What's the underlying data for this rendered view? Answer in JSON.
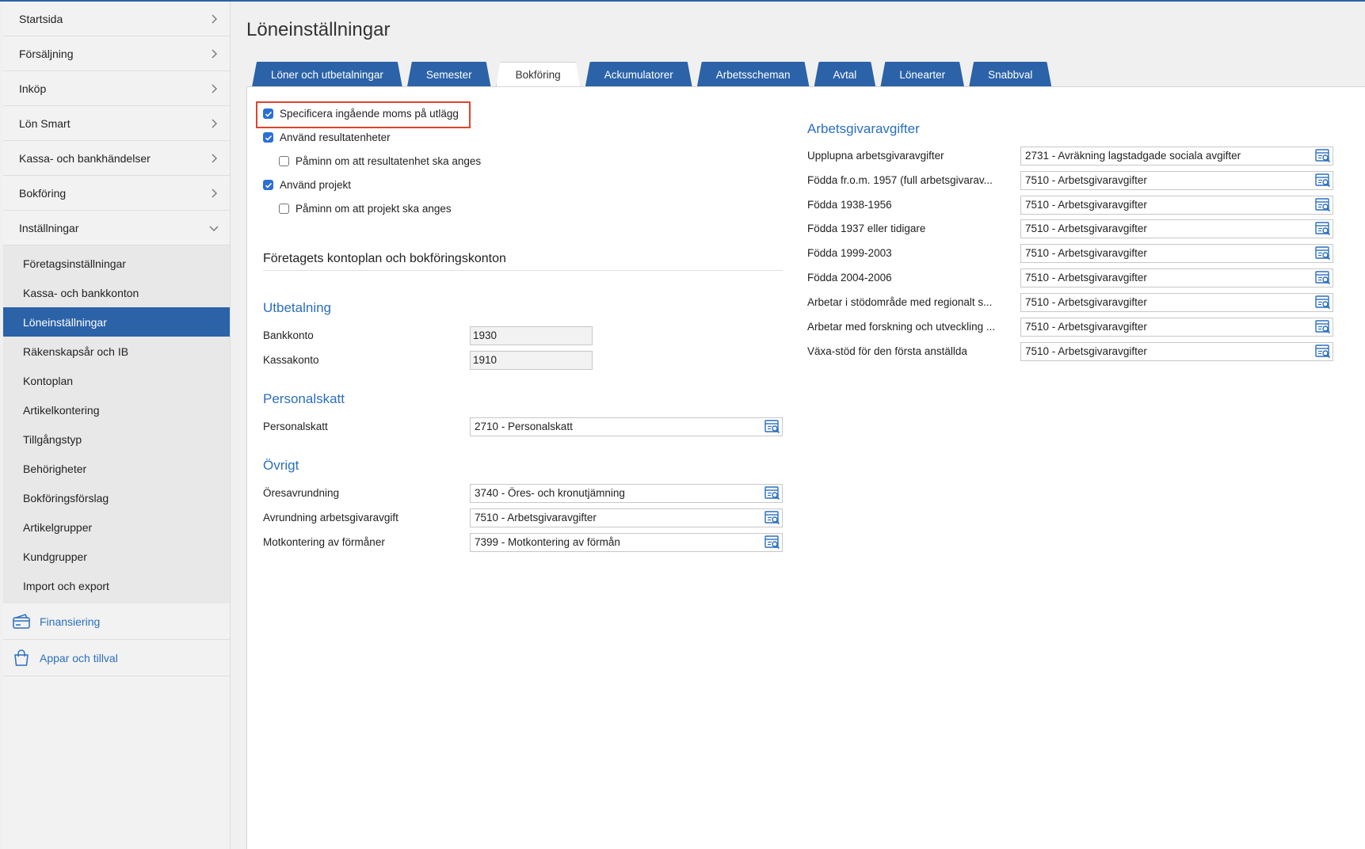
{
  "sidebar": {
    "top_items": [
      {
        "label": "Startsida"
      },
      {
        "label": "Försäljning"
      },
      {
        "label": "Inköp"
      },
      {
        "label": "Lön Smart"
      },
      {
        "label": "Kassa- och bankhändelser"
      },
      {
        "label": "Bokföring"
      },
      {
        "label": "Inställningar"
      }
    ],
    "sub_items": [
      {
        "label": "Företagsinställningar"
      },
      {
        "label": "Kassa- och bankkonton"
      },
      {
        "label": "Löneinställningar"
      },
      {
        "label": "Räkenskapsår och IB"
      },
      {
        "label": "Kontoplan"
      },
      {
        "label": "Artikelkontering"
      },
      {
        "label": "Tillgångstyp"
      },
      {
        "label": "Behörigheter"
      },
      {
        "label": "Bokföringsförslag"
      },
      {
        "label": "Artikelgrupper"
      },
      {
        "label": "Kundgrupper"
      },
      {
        "label": "Import och export"
      }
    ],
    "bottom_items": [
      {
        "label": "Finansiering",
        "icon": "finance-card-icon"
      },
      {
        "label": "Appar och tillval",
        "icon": "shopping-bag-icon"
      }
    ]
  },
  "page": {
    "title": "Löneinställningar"
  },
  "tabs": [
    {
      "label": "Löner och utbetalningar"
    },
    {
      "label": "Semester"
    },
    {
      "label": "Bokföring",
      "active": true
    },
    {
      "label": "Ackumulatorer"
    },
    {
      "label": "Arbetsscheman"
    },
    {
      "label": "Avtal"
    },
    {
      "label": "Lönearter"
    },
    {
      "label": "Snabbval"
    }
  ],
  "checkboxes": [
    {
      "label": "Specificera ingående moms på utlägg",
      "checked": true
    },
    {
      "label": "Använd resultatenheter",
      "checked": true
    },
    {
      "label": "Påminn om att resultatenhet ska anges",
      "checked": false
    },
    {
      "label": "Använd projekt",
      "checked": true
    },
    {
      "label": "Påminn om att projekt ska anges",
      "checked": false
    }
  ],
  "accounts_section": {
    "title": "Företagets kontoplan och bokföringskonton"
  },
  "utbetalning": {
    "title": "Utbetalning",
    "fields": [
      {
        "label": "Bankkonto",
        "value": "1930"
      },
      {
        "label": "Kassakonto",
        "value": "1910"
      }
    ]
  },
  "personalskatt": {
    "title": "Personalskatt",
    "fields": [
      {
        "label": "Personalskatt",
        "value": "2710 - Personalskatt"
      }
    ]
  },
  "ovrigt": {
    "title": "Övrigt",
    "fields": [
      {
        "label": "Öresavrundning",
        "value": "3740 - Öres- och kronutjämning"
      },
      {
        "label": "Avrundning arbetsgivaravgift",
        "value": "7510 - Arbetsgivaravgifter"
      },
      {
        "label": "Motkontering av förmåner",
        "value": "7399 - Motkontering av förmån"
      }
    ]
  },
  "arbetsgivaravgifter": {
    "title": "Arbetsgivaravgifter",
    "fields": [
      {
        "label": "Upplupna arbetsgivaravgifter",
        "value": "2731 - Avräkning lagstadgade sociala avgifter"
      },
      {
        "label": "Födda fr.o.m. 1957 (full arbetsgivarav...",
        "value": "7510 - Arbetsgivaravgifter"
      },
      {
        "label": "Födda 1938-1956",
        "value": "7510 - Arbetsgivaravgifter"
      },
      {
        "label": "Födda 1937 eller tidigare",
        "value": "7510 - Arbetsgivaravgifter"
      },
      {
        "label": "Födda 1999-2003",
        "value": "7510 - Arbetsgivaravgifter"
      },
      {
        "label": "Födda 2004-2006",
        "value": "7510 - Arbetsgivaravgifter"
      },
      {
        "label": "Arbetar i stödområde med regionalt s...",
        "value": "7510 - Arbetsgivaravgifter"
      },
      {
        "label": "Arbetar med forskning och utveckling ...",
        "value": "7510 - Arbetsgivaravgifter"
      },
      {
        "label": "Växa-stöd för den första anställda",
        "value": "7510 - Arbetsgivaravgifter"
      }
    ]
  },
  "colors": {
    "accent": "#2b62a8",
    "link": "#2b6fbf",
    "highlight": "#e0442c"
  }
}
